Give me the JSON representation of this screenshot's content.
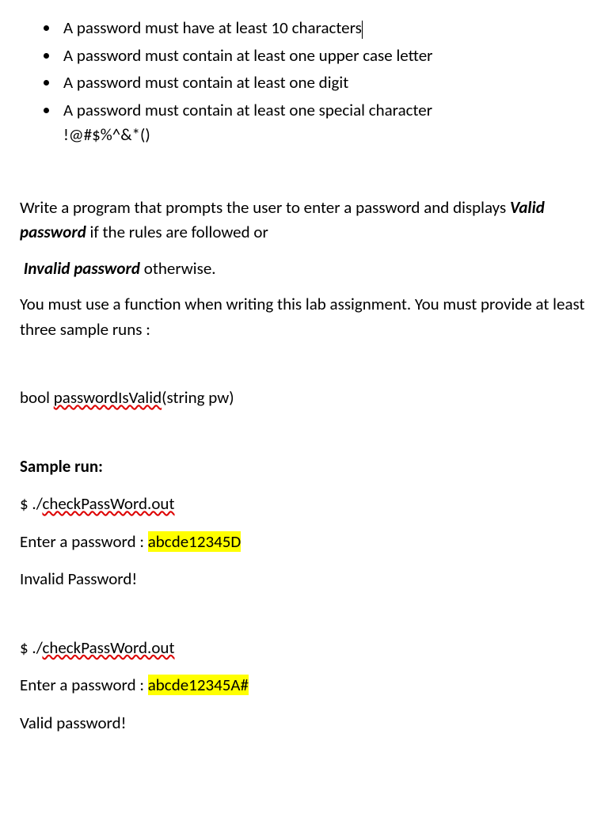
{
  "bullets": {
    "b1_pre": "A password must have at least 10 characters",
    "b2": "A password must contain at least one upper case letter",
    "b3": "A password must contain at least one digit",
    "b4_line1": "A password must contain at least one special character",
    "b4_line2": "!@#$%^&*()"
  },
  "body": {
    "p1_pre": "Write a program that prompts the user to enter a password and displays ",
    "p1_valid": "Valid password",
    "p1_post": " if the rules are followed or",
    "p2_invalid": "Invalid password",
    "p2_post": " otherwise.",
    "p3": "You must use a function when writing this lab assignment. You must provide at least three sample runs :"
  },
  "func": {
    "pre": "bool   ",
    "name": "passwordIsValid",
    "post": "(string   pw)"
  },
  "sample": {
    "heading": "Sample run:",
    "run1": {
      "dollar": "$   ./",
      "cmd": "checkPassWord.out",
      "prompt_pre": "Enter a password  :  ",
      "input": "abcde12345D",
      "result": "Invalid Password!"
    },
    "run2": {
      "dollar": "$  ./",
      "cmd": "checkPassWord.out",
      "prompt_pre": "Enter a password  :  ",
      "input": "abcde12345A#",
      "result": "Valid password!"
    }
  }
}
